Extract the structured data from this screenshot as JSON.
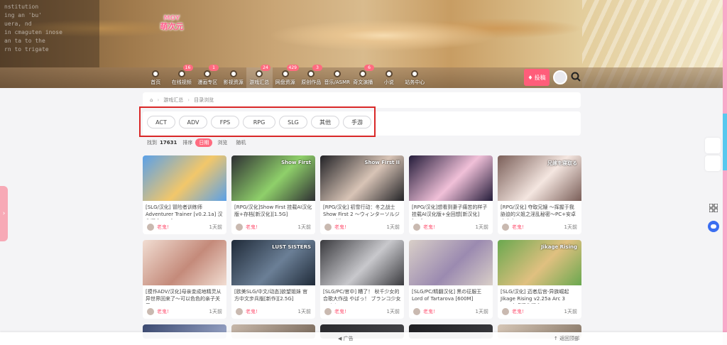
{
  "site": {
    "logo_top": "MOY",
    "logo_bottom": "萌次元"
  },
  "banner_terminal": [
    "nstitution",
    "ing an 'bu'",
    "uera, nd",
    "in cmaguten inose",
    "an ta to the",
    "rn to trigate"
  ],
  "nav": [
    {
      "label": "首页",
      "icon": "home-icon",
      "badge": ""
    },
    {
      "label": "在线视频",
      "icon": "video-icon",
      "badge": "16"
    },
    {
      "label": "漫画专区",
      "icon": "comic-icon",
      "badge": "1"
    },
    {
      "label": "影视资源",
      "icon": "film-icon",
      "badge": ""
    },
    {
      "label": "游戏汇总",
      "icon": "game-icon",
      "badge": "24",
      "active": true
    },
    {
      "label": "网盘资源",
      "icon": "download-icon",
      "badge": "429"
    },
    {
      "label": "原创作品",
      "icon": "pen-icon",
      "badge": "3"
    },
    {
      "label": "音乐/ASMR",
      "icon": "headphone-icon",
      "badge": ""
    },
    {
      "label": "奇文演播",
      "icon": "radio-icon",
      "badge": "6"
    },
    {
      "label": "小说",
      "icon": "book-icon",
      "badge": ""
    },
    {
      "label": "站务中心",
      "icon": "info-icon",
      "badge": ""
    }
  ],
  "header": {
    "contribute": "投稿"
  },
  "breadcrumb": [
    "游戏汇总",
    "目录浏览"
  ],
  "categories": [
    "ACT",
    "ADV",
    "FPS",
    "RPG",
    "SLG",
    "其他",
    "手游"
  ],
  "sort": {
    "found_label": "找到",
    "found_count": "17631",
    "sort_label": "排序",
    "options": [
      "日期",
      "浏览",
      "随机"
    ],
    "active": 0
  },
  "cards": [
    {
      "title": "[SLG/汉化] 冒险者训练师 Adventurer Trainer [v0.2.1a] 汉化版 [2.2G]",
      "author": "老鬼!",
      "time": "1天前",
      "thumb": [
        "#5aa0e8",
        "#f2c76a"
      ],
      "thumb_text": ""
    },
    {
      "title": "[RPG/汉化]Show First 挂载AI汉化版+存档[新汉化][1.5G]",
      "author": "老鬼!",
      "time": "1天前",
      "thumb": [
        "#2e2f33",
        "#8fd06a"
      ],
      "thumb_text": "Show First"
    },
    {
      "title": "[RPG/汉化] 初雪行动：冬之战士 Show First 2 ～ウィンターソルジャーズ作…",
      "author": "老鬼!",
      "time": "1天前",
      "thumb": [
        "#222226",
        "#d8c4b6"
      ],
      "thumb_text": "Show First II"
    },
    {
      "title": "[RPG/汉化]想看到妻子痛苦的样子 挂载AI汉化版+全回想[新汉化][1G]",
      "author": "老鬼!",
      "time": "1天前",
      "thumb": [
        "#241c3a",
        "#f0c0d8"
      ],
      "thumb_text": ""
    },
    {
      "title": "[RPG/汉化] 夺取兄嫂 ～挥握于我胁迫的义姐之淫乱秘密～PC+安卓官方中…",
      "author": "老鬼!",
      "time": "1天前",
      "thumb": [
        "#7a5e58",
        "#f4e6e0"
      ],
      "thumb_text": "兄嫁を寝取る"
    },
    {
      "title": "[摸作ADV/汉化]母亲变成地精灵从异世界回来了～可以色色的亲子关系～AI…",
      "author": "老鬼!",
      "time": "1天前",
      "thumb": [
        "#f1ddd2",
        "#c48a7a"
      ],
      "thumb_text": ""
    },
    {
      "title": "[欧美SLG/中文/动态]欲望姐妹 官方中文步兵版[新作][2.5G]",
      "author": "老鬼!",
      "time": "1天前",
      "thumb": [
        "#1f2a38",
        "#6b7f96"
      ],
      "thumb_text": "LUST SISTERS"
    },
    {
      "title": "[SLG/PC/官中] 糟了！ 秋千少女的合歌大作战 やばっ！ ブランコ少女のオナ…",
      "author": "老鬼!",
      "time": "1天前",
      "thumb": [
        "#3a3a3e",
        "#c8c8cc"
      ],
      "thumb_text": ""
    },
    {
      "title": "[SLG/PC/精翻汉化] 黑の征服王 Lord of Tartarova [600M]",
      "author": "老鬼!",
      "time": "1天前",
      "thumb": [
        "#d9cfc8",
        "#9b8ab0"
      ],
      "thumb_text": ""
    },
    {
      "title": "[SLG/汉化] 迈者后宫-异族崛起 Jikage Rising v2.25a Arc 3 PC+安卓汉化版 […",
      "author": "老鬼!",
      "time": "1天前",
      "thumb": [
        "#6aa84f",
        "#e0c080"
      ],
      "thumb_text": "Jikage Rising"
    }
  ],
  "row3_thumbs": [
    [
      "#3a4870",
      "#9aa6c8"
    ],
    [
      "#c7b7a9",
      "#7a6a5c"
    ],
    [
      "#2a2a2e",
      "#444448"
    ],
    [
      "#1e1e22",
      "#3a3a3e"
    ],
    [
      "#d6c6b6",
      "#8a7a6a"
    ]
  ],
  "left_tab": "›",
  "footer": {
    "ad": "广告",
    "back_top": "返回顶部"
  }
}
